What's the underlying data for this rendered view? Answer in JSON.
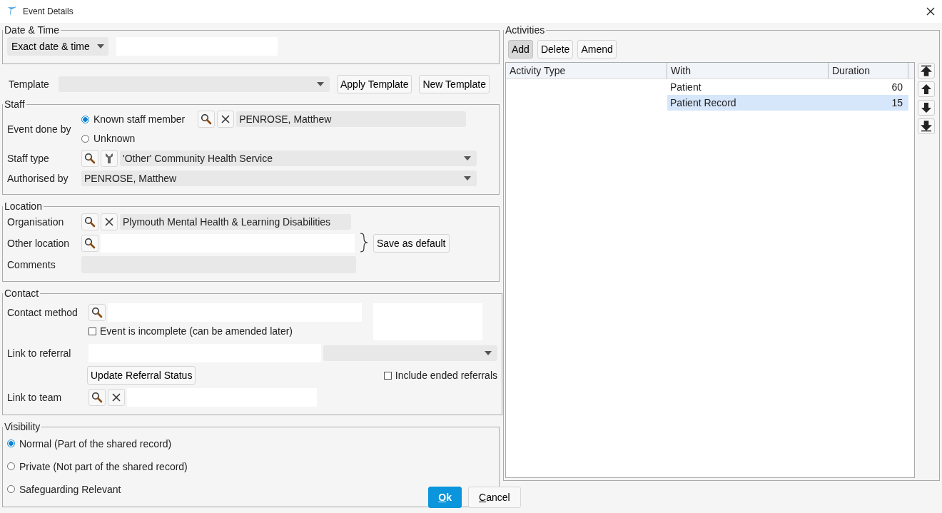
{
  "window": {
    "title": "Event Details"
  },
  "date_time": {
    "legend": "Date & Time",
    "mode": "Exact date & time"
  },
  "template": {
    "label": "Template",
    "buttons": [
      "Apply Template",
      "New Template"
    ]
  },
  "staff": {
    "legend": "Staff",
    "event_done_by": {
      "label": "Event done by",
      "value": "PENROSE, Matthew",
      "options": [
        {
          "label": "Known staff member",
          "selected": true
        },
        {
          "label": "Unknown",
          "selected": false
        }
      ]
    },
    "staff_type": {
      "label": "Staff type",
      "value": "'Other' Community Health Service"
    },
    "authorised_by": {
      "label": "Authorised by",
      "value": "PENROSE, Matthew"
    }
  },
  "location": {
    "legend": "Location",
    "organisation": {
      "label": "Organisation",
      "value": "Plymouth Mental Health & Learning Disabilities"
    },
    "other_location": {
      "label": "Other location"
    },
    "comments": {
      "label": "Comments"
    },
    "save_default": "Save as default"
  },
  "contact": {
    "legend": "Contact",
    "contact_method": {
      "label": "Contact method"
    },
    "incomplete": {
      "label": "Event is incomplete (can be amended later)",
      "checked": false
    },
    "link_to_referral": {
      "label": "Link to referral"
    },
    "update_button": "Update Referral Status",
    "include_ended": {
      "label": "Include ended referrals",
      "checked": false
    },
    "link_to_team": {
      "label": "Link to team"
    }
  },
  "visibility": {
    "legend": "Visibility",
    "options": [
      {
        "label": "Normal (Part of the shared record)",
        "selected": true
      },
      {
        "label": "Private (Not part of the shared record)",
        "selected": false
      },
      {
        "label": "Safeguarding Relevant",
        "selected": false
      }
    ]
  },
  "activities": {
    "legend": "Activities",
    "buttons": [
      {
        "label": "Add",
        "selected": true
      },
      {
        "label": "Delete",
        "selected": false
      },
      {
        "label": "Amend",
        "selected": false
      }
    ],
    "columns": [
      "Activity Type",
      "With",
      "Duration"
    ],
    "rows": [
      {
        "with": "Patient",
        "duration": "60",
        "selected": false
      },
      {
        "with": "Patient Record",
        "duration": "15",
        "selected": true
      }
    ]
  },
  "footer": {
    "buttons": [
      {
        "label": "Ok",
        "kind": "primary"
      },
      {
        "label": "Cancel",
        "kind": "secondary"
      }
    ]
  }
}
